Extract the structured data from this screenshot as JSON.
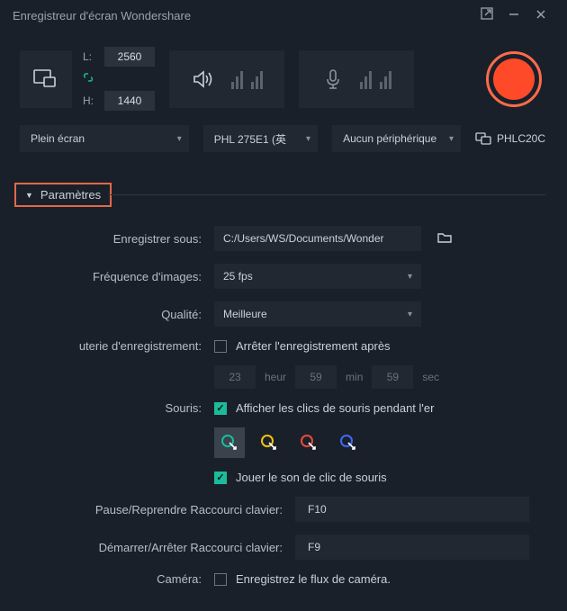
{
  "window": {
    "title": "Enregistreur d'écran Wondershare"
  },
  "dimensions": {
    "width_label": "L:",
    "height_label": "H:",
    "width": "2560",
    "height": "1440"
  },
  "capture_mode": {
    "label": "Plein écran"
  },
  "audio_device": {
    "label": "PHL 275E1 (英"
  },
  "mic_device": {
    "label": "Aucun périphérique"
  },
  "monitor": {
    "label": "PHLC20C"
  },
  "params": {
    "trigger": "Paramètres",
    "save_as_label": "Enregistrer sous:",
    "save_path": "C:/Users/WS/Documents/Wonder",
    "fps_label": "Fréquence d'images:",
    "fps_value": "25 fps",
    "quality_label": "Qualité:",
    "quality_value": "Meilleure",
    "timer_label": "uterie d'enregistrement:",
    "timer_checkbox": "Arrêter l'enregistrement après",
    "timer_h": "23",
    "timer_h_unit": "heur",
    "timer_m": "59",
    "timer_m_unit": "min",
    "timer_s": "59",
    "timer_s_unit": "sec",
    "mouse_label": "Souris:",
    "show_clicks": "Afficher les clics de souris pendant l'er",
    "click_sound": "Jouer le son de clic de souris",
    "pause_hotkey_label": "Pause/Reprendre Raccourci clavier:",
    "pause_hotkey": "F10",
    "start_hotkey_label": "Démarrer/Arrêter Raccourci clavier:",
    "start_hotkey": "F9",
    "camera_label": "Caméra:",
    "camera_checkbox": "Enregistrez le flux de caméra."
  },
  "cursor_colors": [
    "#1abc9c",
    "#f1c40f",
    "#e74c3c",
    "#3f68ff"
  ]
}
